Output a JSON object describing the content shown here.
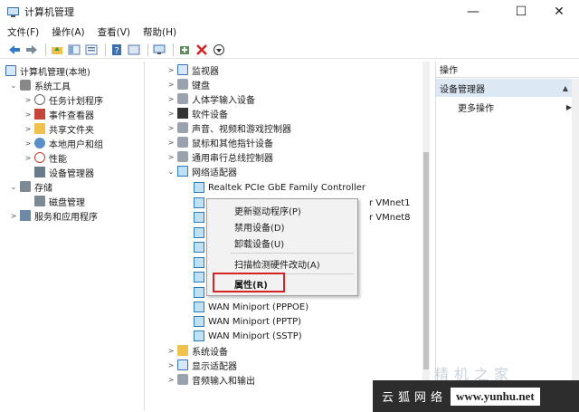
{
  "window": {
    "title": "计算机管理",
    "minimize": "—",
    "maximize": "☐",
    "close": "✕"
  },
  "menubar": [
    "文件(F)",
    "操作(A)",
    "查看(V)",
    "帮助(H)"
  ],
  "left_tree": [
    {
      "label": "计算机管理(本地)",
      "icon": "computer-icon",
      "arrow": ""
    },
    {
      "label": "系统工具",
      "icon": "tools-icon",
      "arrow": "⌄"
    },
    {
      "label": "任务计划程序",
      "icon": "clock-icon",
      "arrow": ">"
    },
    {
      "label": "事件查看器",
      "icon": "event-viewer-icon",
      "arrow": ">"
    },
    {
      "label": "共享文件夹",
      "icon": "shared-folder-icon",
      "arrow": ">"
    },
    {
      "label": "本地用户和组",
      "icon": "users-icon",
      "arrow": ">"
    },
    {
      "label": "性能",
      "icon": "performance-icon",
      "arrow": ">"
    },
    {
      "label": "设备管理器",
      "icon": "device-manager-icon",
      "arrow": ""
    },
    {
      "label": "存储",
      "icon": "storage-icon",
      "arrow": "⌄"
    },
    {
      "label": "磁盘管理",
      "icon": "disk-icon",
      "arrow": ""
    },
    {
      "label": "服务和应用程序",
      "icon": "services-icon",
      "arrow": ">"
    }
  ],
  "device_tree": [
    {
      "label": "监视器",
      "icon": "monitor-icon",
      "arrow": ">"
    },
    {
      "label": "键盘",
      "icon": "keyboard-icon",
      "arrow": ">"
    },
    {
      "label": "人体学输入设备",
      "icon": "hid-icon",
      "arrow": ">"
    },
    {
      "label": "软件设备",
      "icon": "software-device-icon",
      "arrow": ">"
    },
    {
      "label": "声音、视频和游戏控制器",
      "icon": "sound-icon",
      "arrow": ">"
    },
    {
      "label": "鼠标和其他指针设备",
      "icon": "mouse-icon",
      "arrow": ">"
    },
    {
      "label": "通用串行总线控制器",
      "icon": "usb-icon",
      "arrow": ">"
    },
    {
      "label": "网络适配器",
      "icon": "network-adapter-icon",
      "arrow": "⌄"
    },
    {
      "label": "Realtek PCIe GbE Family Controller",
      "icon": "network-card-icon",
      "arrow": ""
    },
    {
      "label": "r VMnet1",
      "icon": "network-card-icon",
      "arrow": ""
    },
    {
      "label": "r VMnet8",
      "icon": "network-card-icon",
      "arrow": ""
    },
    {
      "label": "",
      "icon": "network-card-icon",
      "arrow": ""
    },
    {
      "label": "",
      "icon": "network-card-icon",
      "arrow": ""
    },
    {
      "label": "",
      "icon": "network-card-icon",
      "arrow": ""
    },
    {
      "label": "",
      "icon": "network-card-icon",
      "arrow": ""
    },
    {
      "label": "",
      "icon": "network-card-icon",
      "arrow": ""
    },
    {
      "label": "WAN Miniport (PPPOE)",
      "icon": "network-card-icon",
      "arrow": ""
    },
    {
      "label": "WAN Miniport (PPTP)",
      "icon": "network-card-icon",
      "arrow": ""
    },
    {
      "label": "WAN Miniport (SSTP)",
      "icon": "network-card-icon",
      "arrow": ""
    },
    {
      "label": "系统设备",
      "icon": "system-device-icon",
      "arrow": ">"
    },
    {
      "label": "显示适配器",
      "icon": "display-adapter-icon",
      "arrow": ">"
    },
    {
      "label": "音频输入和输出",
      "icon": "audio-icon",
      "arrow": ">"
    }
  ],
  "context_menu": {
    "update_driver": "更新驱动程序(P)",
    "disable_device": "禁用设备(D)",
    "uninstall_device": "卸载设备(U)",
    "scan_hardware": "扫描检测硬件改动(A)",
    "properties": "属性(R)"
  },
  "actions": {
    "header": "操作",
    "selected": "设备管理器",
    "more": "更多操作",
    "selected_arrow": "▲",
    "more_arrow": "▶"
  },
  "watermark": {
    "cn": "云狐网络",
    "url": "www.yunhu.net",
    "ghost": "精机之家"
  },
  "colors": {
    "highlight_border": "#d42323",
    "selection_bg": "#dde8f5",
    "watermark_bg": "#2d2d2d"
  }
}
